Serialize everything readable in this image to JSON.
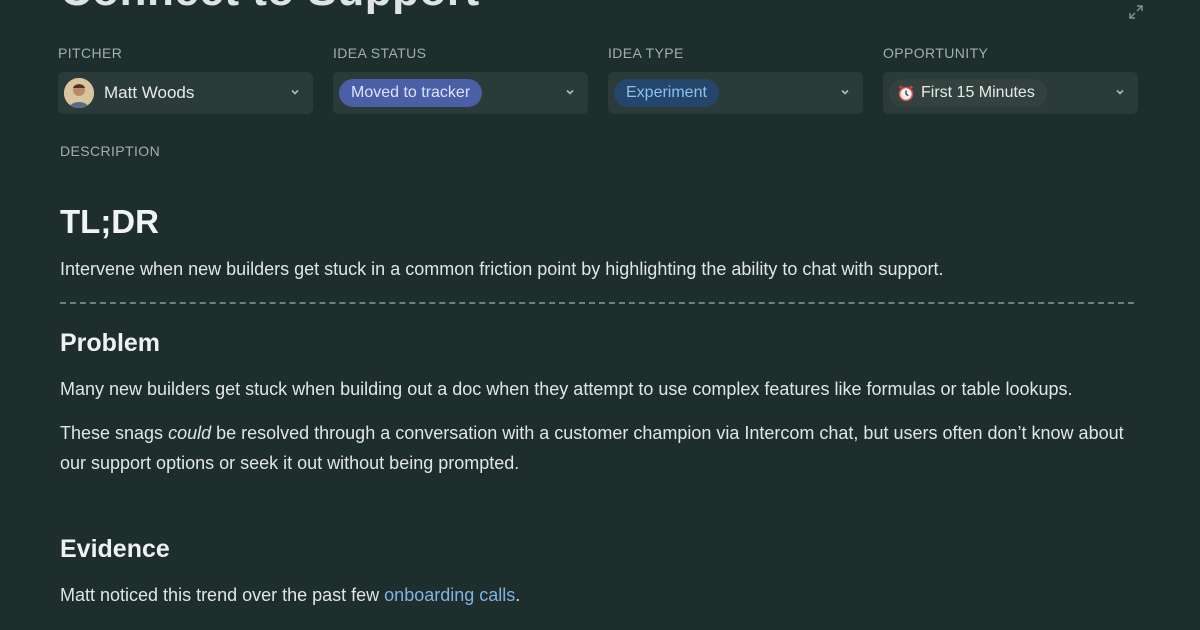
{
  "page": {
    "title": "Connect to Support"
  },
  "fields": {
    "pitcher": {
      "label": "PITCHER",
      "value": "Matt Woods"
    },
    "idea_status": {
      "label": "IDEA STATUS",
      "value": "Moved to tracker",
      "color": "#4a5fa6"
    },
    "idea_type": {
      "label": "IDEA TYPE",
      "value": "Experiment",
      "color": "#23466a"
    },
    "opportunity": {
      "label": "OPPORTUNITY",
      "value": "First 15 Minutes",
      "icon": "alarm-clock-icon"
    }
  },
  "description": {
    "label": "DESCRIPTION",
    "tldr_heading": "TL;DR",
    "tldr_text": "Intervene when new builders get stuck in a common friction point by highlighting the ability to chat with support.",
    "problem_heading": "Problem",
    "problem_p1": "Many new builders get stuck when building out a doc when they attempt to use complex features like formulas or table lookups.",
    "problem_p2_before": "These snags ",
    "problem_p2_emph": "could",
    "problem_p2_after": " be resolved through a conversation with a customer champion via Intercom chat, but users often don’t know about our support options or seek it out without being prompted.",
    "evidence_heading": "Evidence",
    "evidence_before": "Matt noticed this trend over the past few ",
    "evidence_link": "onboarding calls",
    "evidence_after": "."
  },
  "colors": {
    "background": "#1d2e2d",
    "field_background": "#2a3b3a",
    "link": "#7fb4e2"
  }
}
